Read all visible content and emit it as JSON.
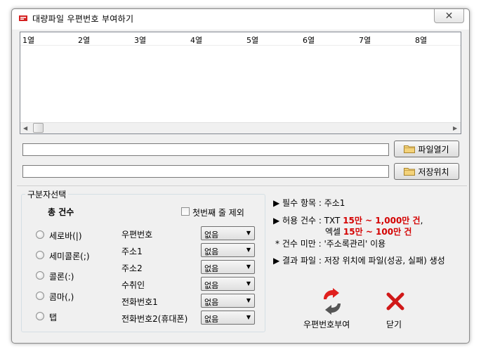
{
  "window": {
    "title": "대량파일 우편번호 부여하기",
    "close_glyph": "✕",
    "app_icon": "dp-app-icon"
  },
  "grid": {
    "columns": [
      "1열",
      "2열",
      "3열",
      "4열",
      "5열",
      "6열",
      "7열",
      "8열"
    ],
    "scroll_left": "◀",
    "scroll_right": "▶"
  },
  "file": {
    "open_path": "",
    "open_button": "파일열기",
    "save_path": "",
    "save_button": "저장위치"
  },
  "delimiter": {
    "legend": "구분자선택",
    "total_label": "총 건수",
    "skip_first_row": "첫번째 줄 제외",
    "options": [
      "세로바(|)",
      "세미콜론(;)",
      "콜론(:)",
      "콤마(,)",
      "탭"
    ],
    "fields": [
      {
        "label": "우편번호",
        "value": "없음"
      },
      {
        "label": "주소1",
        "value": "없음"
      },
      {
        "label": "주소2",
        "value": "없음"
      },
      {
        "label": "수취인",
        "value": "없음"
      },
      {
        "label": "전화번호1",
        "value": "없음"
      },
      {
        "label": "전화번호2(휴대폰)",
        "value": "없음"
      }
    ]
  },
  "info": {
    "line1": "▶ 필수 항목 : 주소1",
    "line2_prefix": "▶ 허용 건수 : TXT ",
    "line2_red": "15만 ~ 1,000만 건",
    "line2_suffix": ",",
    "line3_prefix": "엑셀 ",
    "line3_red": "15만 ~ 100만 건",
    "line4": "* 건수 미만 : '주소록관리' 이용",
    "line5": "▶ 결과 파일 : 저장 위치에 파일(성공, 실패) 생성"
  },
  "actions": {
    "assign_label": "우편번호부여",
    "close_label": "닫기"
  },
  "colors": {
    "accent_red": "#d40000",
    "refresh_red": "#e0201e",
    "refresh_gray": "#555555"
  }
}
